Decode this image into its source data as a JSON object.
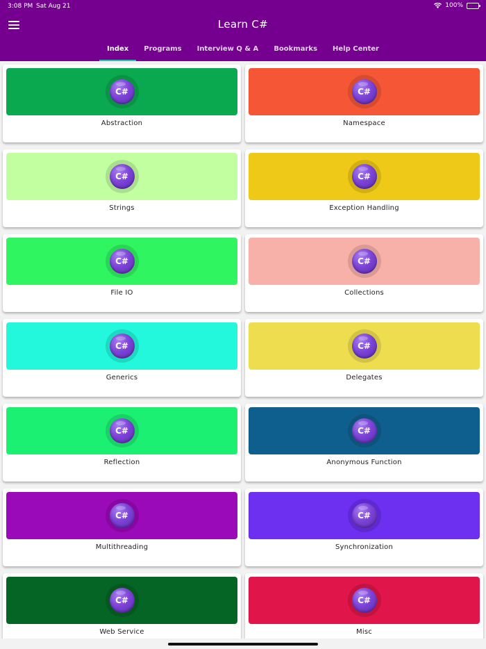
{
  "status_bar": {
    "time": "3:08 PM",
    "date": "Sat Aug 21",
    "battery": "100%"
  },
  "app": {
    "title": "Learn C#",
    "menu_icon": "hamburger-menu-icon"
  },
  "tabs": [
    {
      "label": "Index",
      "active": true
    },
    {
      "label": "Programs",
      "active": false
    },
    {
      "label": "Interview Q & A",
      "active": false
    },
    {
      "label": "Bookmarks",
      "active": false
    },
    {
      "label": "Help Center",
      "active": false
    }
  ],
  "topic_icon": {
    "name": "csharp-logo-icon",
    "text": "C#"
  },
  "topics": [
    {
      "label": "Abstraction",
      "color": "#0aa84f"
    },
    {
      "label": "Namespace",
      "color": "#f55635"
    },
    {
      "label": "Strings",
      "color": "#c2ffa1"
    },
    {
      "label": "Exception Handling",
      "color": "#efc917"
    },
    {
      "label": "File IO",
      "color": "#2ef560"
    },
    {
      "label": "Collections",
      "color": "#f8b1a9"
    },
    {
      "label": "Generics",
      "color": "#23f7dc"
    },
    {
      "label": "Delegates",
      "color": "#efdd50"
    },
    {
      "label": "Reflection",
      "color": "#1cf073"
    },
    {
      "label": "Anonymous Function",
      "color": "#0f5f8e"
    },
    {
      "label": "Multithreading",
      "color": "#9a0ab8"
    },
    {
      "label": "Synchronization",
      "color": "#6d2ff0"
    },
    {
      "label": "Web Service",
      "color": "#056524"
    },
    {
      "label": "Misc",
      "color": "#e0154a"
    }
  ],
  "theme": {
    "primary": "#75008f",
    "tab_indicator": "#22c7a9"
  }
}
